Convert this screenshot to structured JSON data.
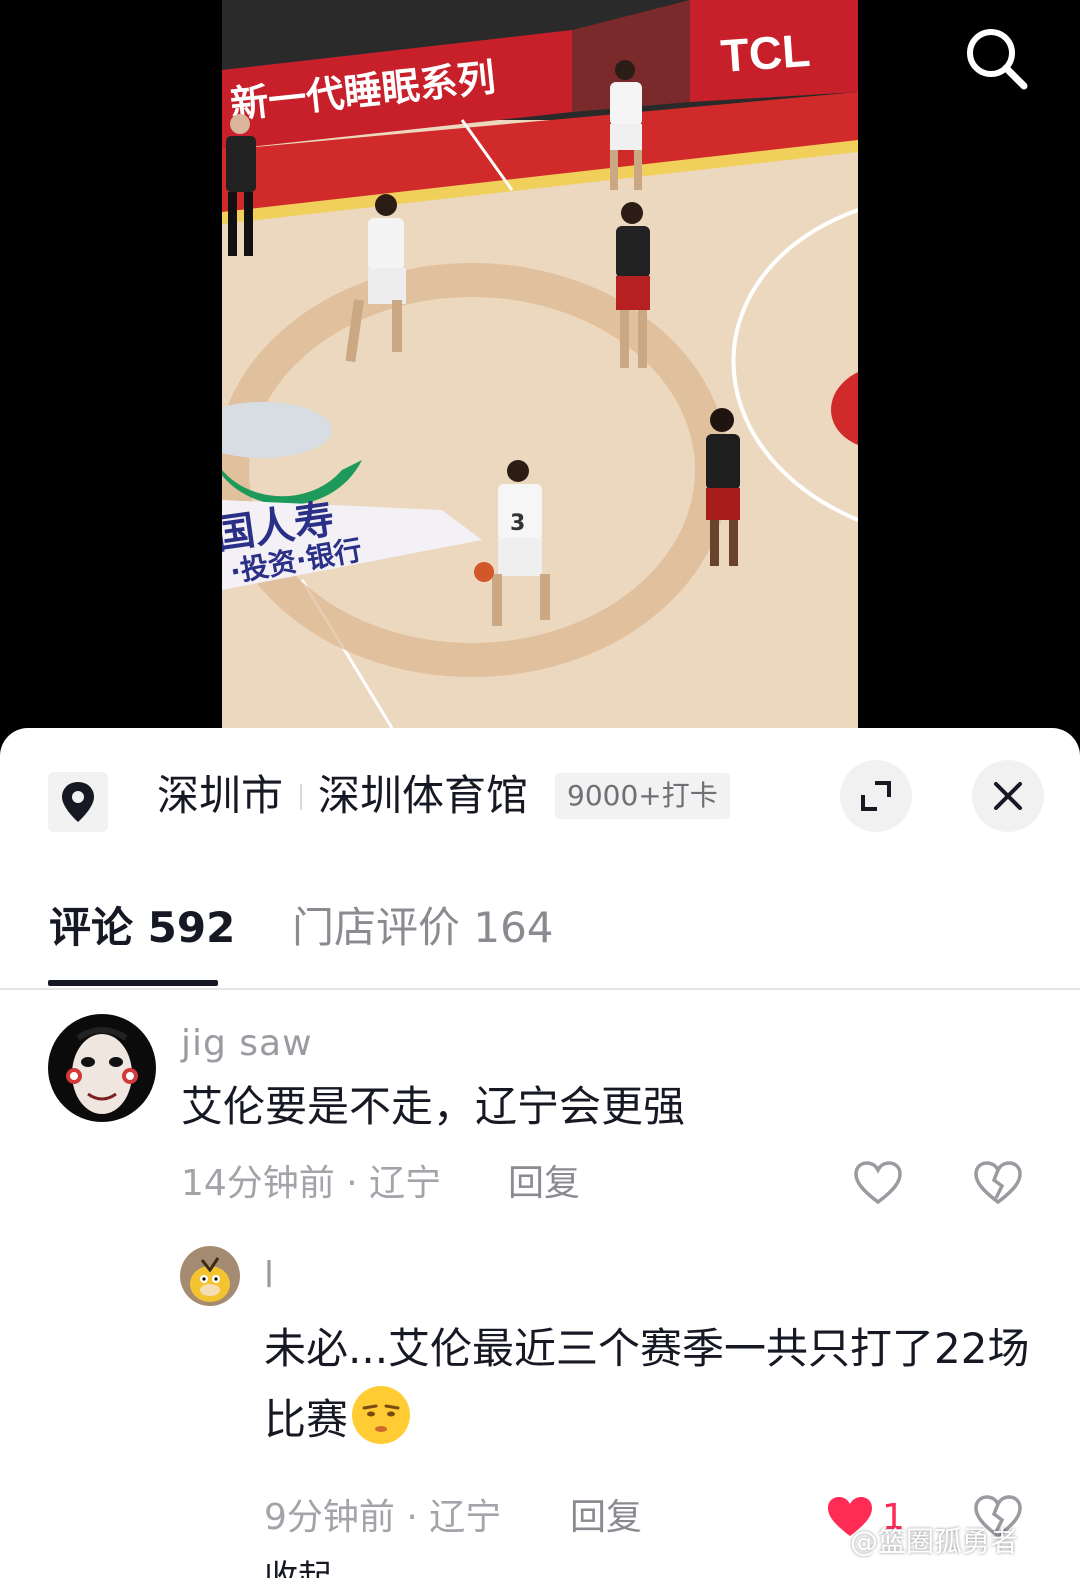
{
  "video": {
    "banner_text": "新一代睡眠系列",
    "sponsor_logo": "TCL",
    "court_logo_line1": "国人寿",
    "court_logo_line2": "·投资·银行"
  },
  "location": {
    "city": "深圳市",
    "venue": "深圳体育馆",
    "checkins": "9000+打卡"
  },
  "tabs": {
    "comments_label": "评论 592",
    "reviews_label": "门店评价 164"
  },
  "comments": [
    {
      "username": "jig saw",
      "text": "艾伦要是不走，辽宁会更强",
      "meta": "14分钟前 · 辽宁",
      "reply_label": "回复"
    },
    {
      "username": "l",
      "text": "未必...艾伦最近三个赛季一共只打了22场比赛",
      "meta": "9分钟前 · 辽宁",
      "reply_label": "回复",
      "likes": "1",
      "liked": true
    }
  ],
  "collapse_label": "收起",
  "watermark": "@篮圈孤勇者",
  "colors": {
    "like_red": "#fe2c55",
    "text": "#161823",
    "muted": "#a3a4a9"
  },
  "icons": [
    "search-icon",
    "location-pin-icon",
    "expand-icon",
    "close-icon",
    "heart-icon",
    "broken-heart-icon",
    "smirk-emoji-icon"
  ]
}
